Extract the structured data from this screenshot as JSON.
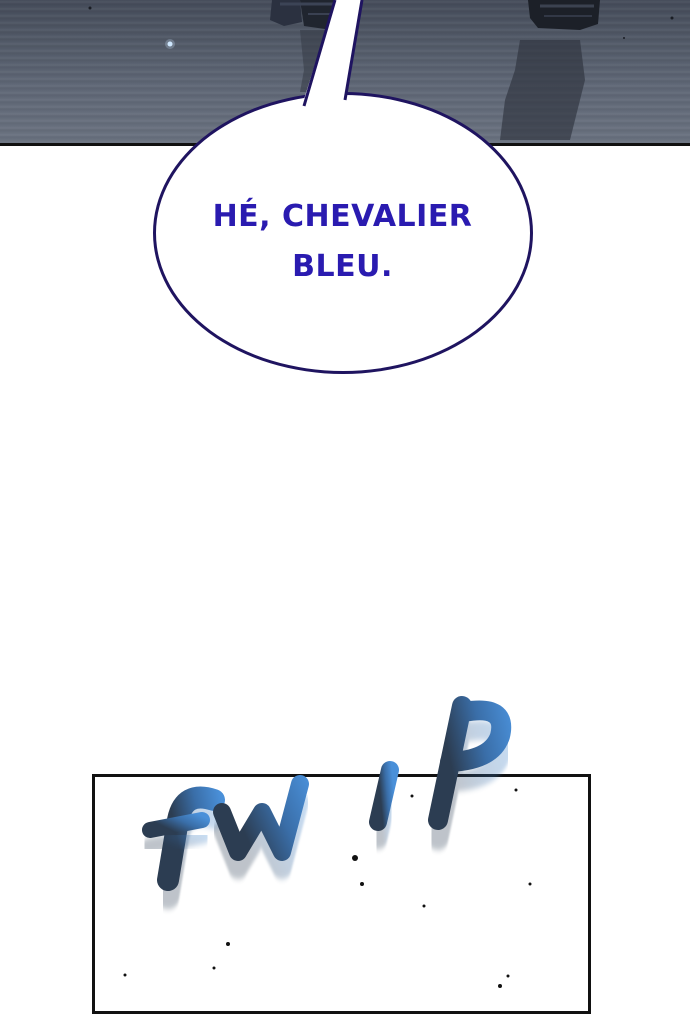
{
  "speech_bubble": {
    "line1": "HÉ, CHEVALIER",
    "line2": "BLEU."
  },
  "sound_effect": {
    "text": "fwip",
    "color": "#4a90d9"
  },
  "colors": {
    "bubble_text": "#2a1bb0",
    "bubble_border": "#1f1460",
    "panel_border": "#111111",
    "water": "#5a6270"
  }
}
